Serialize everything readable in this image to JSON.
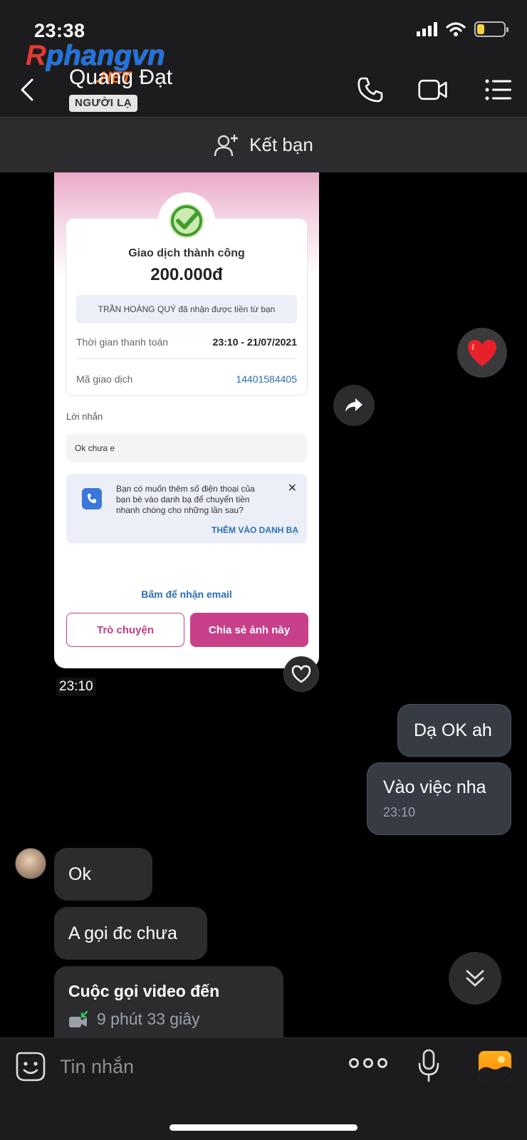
{
  "status_bar": {
    "time": "23:38",
    "battery_level": 0.25,
    "icons": [
      "signal-icon",
      "wifi-icon",
      "battery-icon"
    ]
  },
  "watermark": {
    "r": "R",
    "main": "phangvn",
    "net": ".NET"
  },
  "header": {
    "contact_name": "Quang Đạt",
    "badge": "NGƯỜI LẠ",
    "icons": [
      "back-icon",
      "phone-icon",
      "video-call-icon",
      "menu-icon"
    ]
  },
  "friend_bar": {
    "label": "Kết bạn",
    "icon": "add-friend-icon"
  },
  "receipt": {
    "title": "Giao dịch thành công",
    "amount": "200.000đ",
    "received_note": "TRẦN HOÀNG QUÝ đã nhận được tiền từ bạn",
    "pay_time_label": "Thời gian thanh toán",
    "pay_time_value": "23:10 - 21/07/2021",
    "txn_label": "Mã giao dịch",
    "txn_value": "14401584405",
    "message_label": "Lời nhắn",
    "message_value": "Ok chưa e",
    "tip_text": "Bạn có muốn thêm số điện thoại của bạn bè vào danh bạ để chuyển tiền nhanh chóng cho những lần sau?",
    "tip_close": "✕",
    "tip_action": "THÊM VÀO DANH BẠ",
    "email_link": "Bấm để nhận email",
    "chat_button": "Trò chuyện",
    "share_button": "Chia sẻ ảnh này",
    "time": "23:10"
  },
  "messages": [
    {
      "direction": "out",
      "text": "Dạ OK ah"
    },
    {
      "direction": "out",
      "text": "Vào việc nha",
      "time": "23:10"
    },
    {
      "direction": "in",
      "text": "Ok"
    },
    {
      "direction": "in",
      "text": "A gọi đc chưa"
    },
    {
      "direction": "in",
      "text": "Cuộc gọi video đến",
      "detail": "9 phút 33 giây"
    }
  ],
  "composer": {
    "placeholder": "Tin nhắn",
    "icons": [
      "sticker-icon",
      "more-icon",
      "microphone-icon",
      "image-icon"
    ]
  },
  "colors": {
    "background": "#000000",
    "header": "#1c1c1e",
    "outgoing_bubble": "#363b44",
    "incoming_bubble": "#2c2c2e",
    "accent_pink": "#c8408a",
    "link_blue": "#2a6fb5"
  }
}
